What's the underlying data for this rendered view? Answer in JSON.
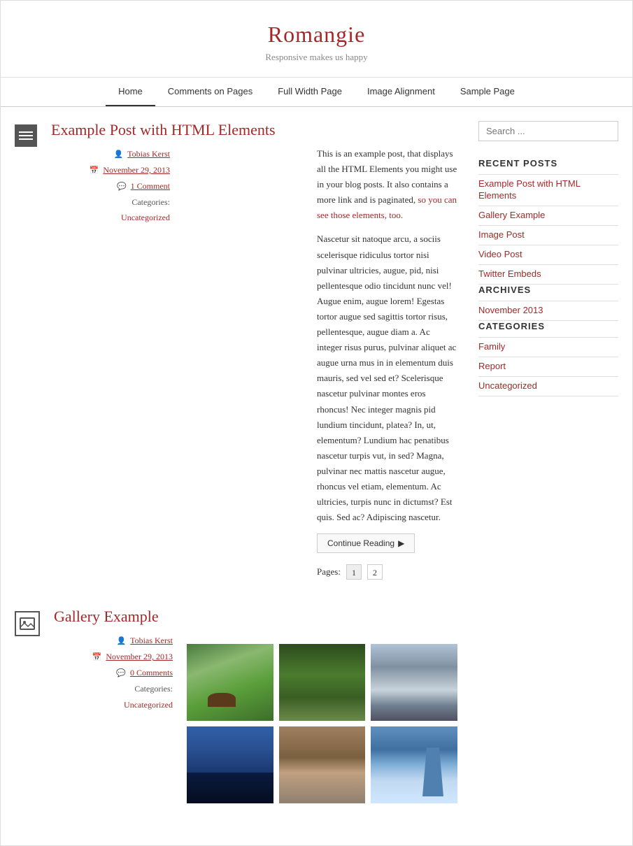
{
  "site": {
    "title": "Romangie",
    "tagline": "Responsive makes us happy"
  },
  "nav": {
    "items": [
      {
        "label": "Home",
        "active": true
      },
      {
        "label": "Comments on Pages",
        "active": false
      },
      {
        "label": "Full Width Page",
        "active": false
      },
      {
        "label": "Image Alignment",
        "active": false
      },
      {
        "label": "Sample Page",
        "active": false
      }
    ]
  },
  "posts": [
    {
      "id": "post-1",
      "icon_type": "lines",
      "title": "Example Post with HTML Elements",
      "author": "Tobias Kerst",
      "date": "November 29, 2013",
      "comments": "1 Comment",
      "categories_label": "Categories:",
      "category": "Uncategorized",
      "excerpt_1": "This is an example post, that displays all the HTML Elements you might use in your blog posts. It also contains a more link and is paginated, ",
      "excerpt_link": "so you can see those elements, too.",
      "excerpt_2": "Nascetur sit natoque arcu, a sociis scelerisque ridiculus tortor nisi pulvinar ultricies, augue, pid, nisi pellentesque odio tincidunt nunc vel! Augue enim, augue lorem! Egestas tortor augue sed sagittis tortor risus, pellentesque, augue diam a. Ac integer risus purus, pulvinar aliquet ac augue urna mus in in elementum duis mauris, sed vel sed et? Scelerisque nascetur pulvinar montes eros rhoncus! Nec integer magnis pid lundium tincidunt, platea? In, ut, elementum? Lundium hac penatibus nascetur turpis vut, in sed? Magna, pulvinar nec mattis nascetur augue, rhoncus vel etiam, elementum. Ac ultricies, turpis nunc in dictumst? Est quis. Sed ac? Adipiscing nascetur.",
      "continue_label": "Continue Reading",
      "pages_label": "Pages:",
      "pages": [
        "1",
        "2"
      ]
    },
    {
      "id": "post-2",
      "icon_type": "gallery",
      "title": "Gallery Example",
      "author": "Tobias Kerst",
      "date": "November 29, 2013",
      "comments": "0 Comments",
      "categories_label": "Categories:",
      "category": "Uncategorized"
    }
  ],
  "sidebar": {
    "search_placeholder": "Search ...",
    "recent_posts_label": "RECENT POSTS",
    "recent_posts": [
      {
        "label": "Example Post with HTML Elements"
      },
      {
        "label": "Gallery Example"
      },
      {
        "label": "Image Post"
      },
      {
        "label": "Video Post"
      },
      {
        "label": "Twitter Embeds"
      }
    ],
    "archives_label": "ARCHIVES",
    "archives": [
      {
        "label": "November 2013"
      }
    ],
    "categories_label": "CATEGORIES",
    "categories": [
      {
        "label": "Family"
      },
      {
        "label": "Report"
      },
      {
        "label": "Uncategorized"
      }
    ]
  },
  "colors": {
    "accent": "#a52828",
    "border": "#e0e0e0"
  }
}
